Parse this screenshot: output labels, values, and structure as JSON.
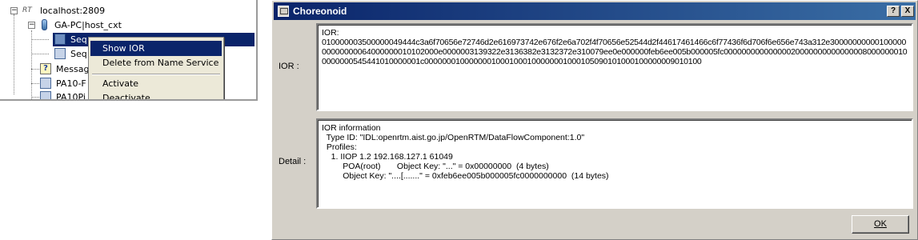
{
  "tree": {
    "root": {
      "badge": "RT",
      "label": "localhost:2809"
    },
    "context": {
      "label": "GA-PC|host_cxt"
    },
    "items": [
      {
        "label": "Seq"
      },
      {
        "label": "Seq"
      },
      {
        "label": "Messag"
      },
      {
        "label": "PA10-F"
      },
      {
        "label": "PA10Pi"
      }
    ]
  },
  "context_menu": {
    "items": [
      {
        "label": "Show IOR",
        "highlighted": true
      },
      {
        "label": "Delete from Name Service"
      },
      {
        "label": "Activate"
      },
      {
        "label": "Deactivate"
      }
    ]
  },
  "dialog": {
    "title": "Choreonoid",
    "help_button": "?",
    "close_button": "X",
    "ior_label": "IOR :",
    "ior_heading": "IOR:",
    "ior_value": "010000003500000049444c3a6f70656e72746d2e616973742e676f2e6a702f4f70656e52544d2f44617461466c6f77436f6d706f6e656e743a312e3000000000010000000000000064000000010102000e0000003139322e3136382e3132372e310079ee0e000000feb6ee005b000005fc000000000000000200000000000000080000000100000000545441010000001c00000001000000010001000100000001000105090101000100000009010100",
    "detail_label": "Detail :",
    "detail_lines": [
      "IOR information",
      "  Type ID: \"IDL:openrtm.aist.go.jp/OpenRTM/DataFlowComponent:1.0\"",
      "  Profiles:",
      "    1. IIOP 1.2 192.168.127.1 61049",
      "         POA(root)       Object Key: \"...\" = 0x00000000  (4 bytes)",
      "         Object Key: \"....[.......\" = 0xfeb6ee005b000005fc0000000000  (14 bytes)"
    ],
    "ok_button": "OK"
  },
  "colors": {
    "titlebar_start": "#0a246a",
    "titlebar_end": "#3a6ea5",
    "selection": "#0a246a",
    "dialog_face": "#d4d0c8"
  }
}
